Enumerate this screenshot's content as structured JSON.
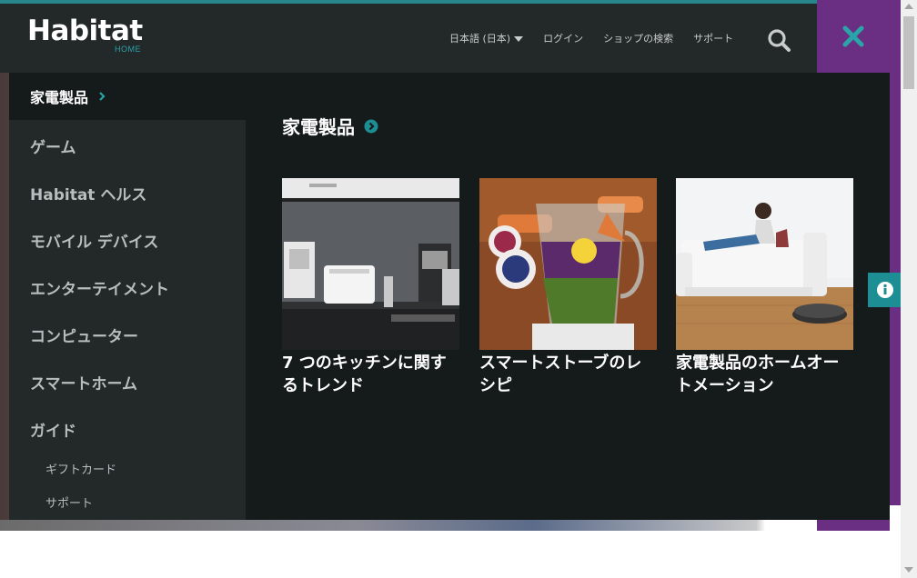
{
  "brand": {
    "name": "Habitat",
    "sub": "HOME"
  },
  "header": {
    "language": "日本語 (日本)",
    "login": "ログイン",
    "store_finder": "ショップの検索",
    "support": "サポート"
  },
  "icons": {
    "search": "search-icon",
    "close": "close-icon",
    "info": "info-icon",
    "chevron": "chevron-right-icon",
    "circle_arrow": "circle-arrow-icon"
  },
  "colors": {
    "accent": "#1d8e94",
    "header_bg": "#232829",
    "menu_bg": "#151a1b",
    "purple": "#6a2f82"
  },
  "sidebar": {
    "active": "家電製品",
    "items": [
      "ゲーム",
      "Habitat ヘルス",
      "モバイル デバイス",
      "エンターテイメント",
      "コンピューター",
      "スマートホーム",
      "ガイド"
    ],
    "sub_items": [
      "ギフトカード",
      "サポート"
    ]
  },
  "content": {
    "title": "家電製品",
    "cards": [
      {
        "title": "7 つのキッチンに関するトレンド"
      },
      {
        "title": "スマートストーブのレシピ"
      },
      {
        "title": "家電製品のホームオートメーション"
      }
    ]
  }
}
